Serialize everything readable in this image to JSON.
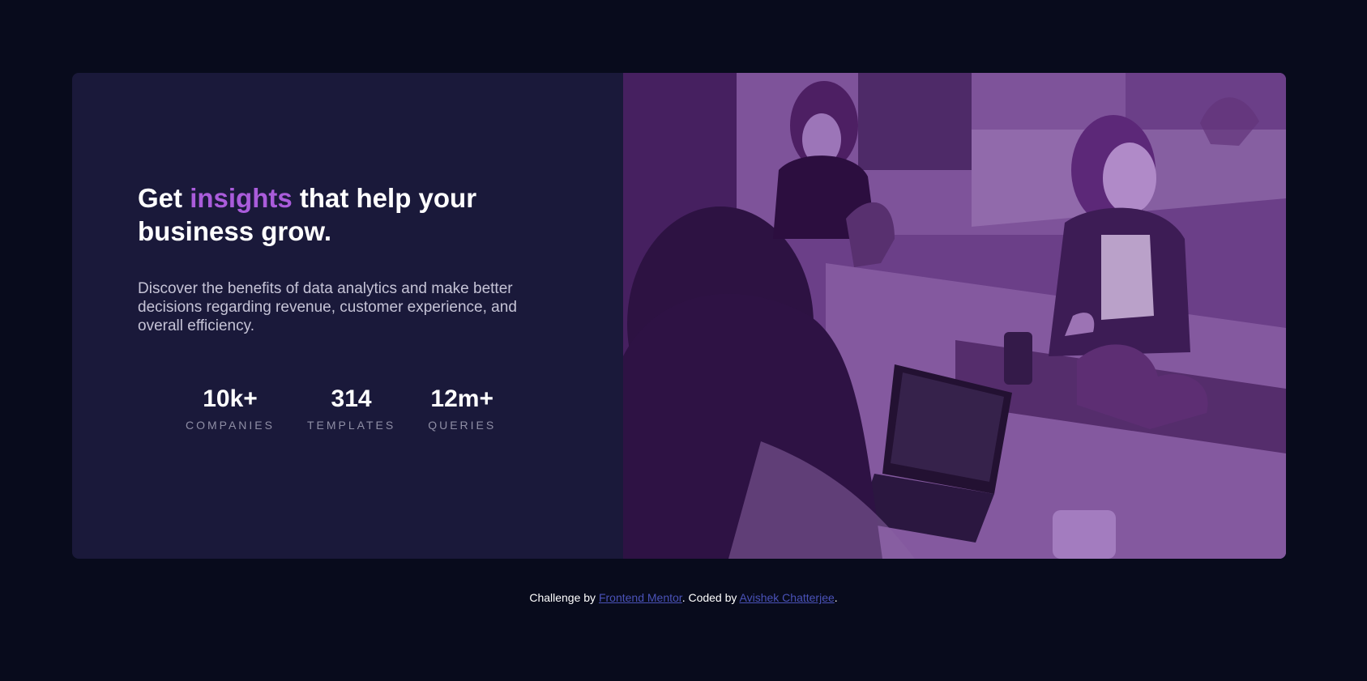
{
  "card": {
    "headline": {
      "before": "Get ",
      "accent": "insights",
      "after": " that help your business grow."
    },
    "description": "Discover the benefits of data analytics and make better decisions regarding revenue, customer experience, and overall efficiency.",
    "stats": [
      {
        "value": "10k+",
        "label": "COMPANIES"
      },
      {
        "value": "314",
        "label": "TEMPLATES"
      },
      {
        "value": "12m+",
        "label": "QUERIES"
      }
    ]
  },
  "attribution": {
    "prefix": "Challenge by ",
    "challenge_link": "Frontend Mentor",
    "middle": ". Coded by ",
    "author_link": "Avishek Chatterjee",
    "suffix": "."
  },
  "colors": {
    "page_background": "#080b1c",
    "card_background": "#1a193a",
    "accent": "#aa5cdb",
    "image_overlay": "#6a3d86",
    "link": "#4a52b8"
  }
}
